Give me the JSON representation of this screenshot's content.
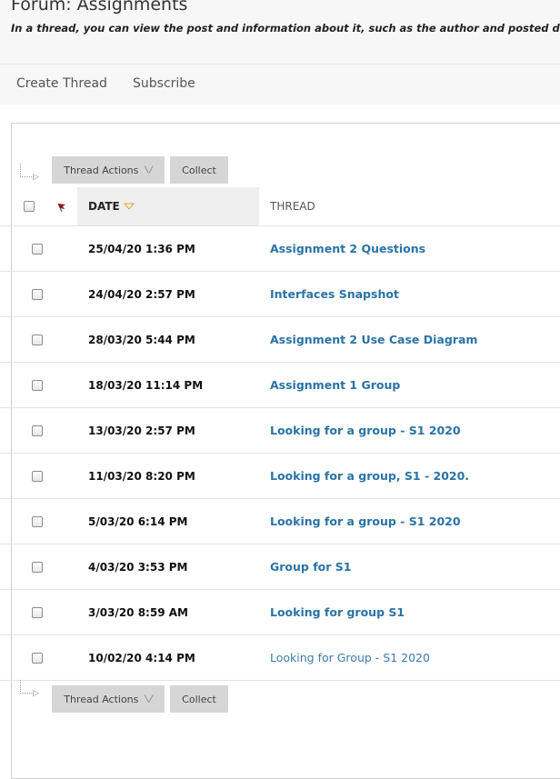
{
  "page": {
    "title": "Forum: Assignments",
    "description": "In a thread, you can view the post and information about it, such as the author and posted date. All"
  },
  "action_bar": {
    "create_thread": "Create Thread",
    "subscribe": "Subscribe"
  },
  "toolbar": {
    "thread_actions": "Thread Actions",
    "collect": "Collect"
  },
  "table": {
    "headers": {
      "date": "DATE",
      "thread": "THREAD"
    },
    "sort": {
      "column": "date",
      "direction": "descending"
    },
    "rows": [
      {
        "date": "25/04/20 1:36 PM",
        "thread": "Assignment 2 Questions",
        "unread": true
      },
      {
        "date": "24/04/20 2:57 PM",
        "thread": "Interfaces Snapshot",
        "unread": true
      },
      {
        "date": "28/03/20 5:44 PM",
        "thread": "Assignment 2 Use Case Diagram",
        "unread": true
      },
      {
        "date": "18/03/20 11:14 PM",
        "thread": "Assignment 1 Group",
        "unread": true
      },
      {
        "date": "13/03/20 2:57 PM",
        "thread": "Looking for a group - S1 2020",
        "unread": true
      },
      {
        "date": "11/03/20 8:20 PM",
        "thread": "Looking for a group, S1 - 2020.",
        "unread": true
      },
      {
        "date": "5/03/20 6:14 PM",
        "thread": "Looking for a group - S1 2020",
        "unread": true
      },
      {
        "date": "4/03/20 3:53 PM",
        "thread": "Group for S1",
        "unread": true
      },
      {
        "date": "3/03/20 8:59 AM",
        "thread": "Looking for group S1",
        "unread": true
      },
      {
        "date": "10/02/20 4:14 PM",
        "thread": "Looking for Group - S1 2020",
        "unread": false
      }
    ]
  },
  "colors": {
    "link": "#2a73a6",
    "flag": "#8b1a1a",
    "sort_arrow": "#d9a441",
    "button": "#d6d6d6"
  }
}
